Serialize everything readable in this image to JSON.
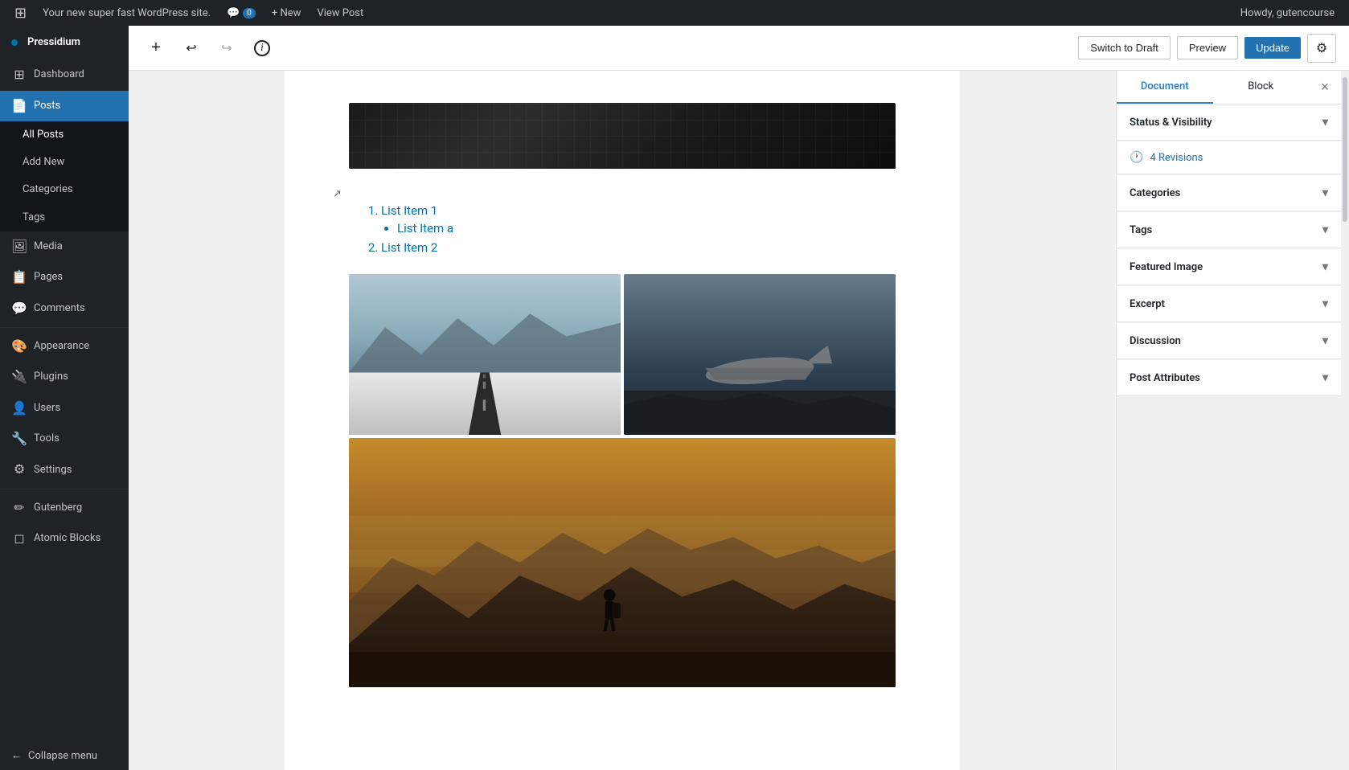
{
  "adminBar": {
    "wpLogoLabel": "WordPress",
    "siteName": "Your new super fast WordPress site.",
    "commentsLabel": "Comments",
    "commentsCount": "0",
    "newLabel": "+ New",
    "viewPostLabel": "View Post",
    "howdy": "Howdy, gutencourse"
  },
  "sidebar": {
    "brandName": "Pressidium",
    "items": [
      {
        "id": "dashboard",
        "label": "Dashboard",
        "icon": "⊞"
      },
      {
        "id": "posts",
        "label": "Posts",
        "icon": "📄",
        "active": true
      },
      {
        "id": "media",
        "label": "Media",
        "icon": "🖼"
      },
      {
        "id": "pages",
        "label": "Pages",
        "icon": "📋"
      },
      {
        "id": "comments",
        "label": "Comments",
        "icon": "💬"
      },
      {
        "id": "appearance",
        "label": "Appearance",
        "icon": "🎨"
      },
      {
        "id": "plugins",
        "label": "Plugins",
        "icon": "🔌"
      },
      {
        "id": "users",
        "label": "Users",
        "icon": "👤"
      },
      {
        "id": "tools",
        "label": "Tools",
        "icon": "🔧"
      },
      {
        "id": "settings",
        "label": "Settings",
        "icon": "⚙"
      },
      {
        "id": "gutenberg",
        "label": "Gutenberg",
        "icon": "✏"
      },
      {
        "id": "atomic-blocks",
        "label": "Atomic Blocks",
        "icon": "◻"
      }
    ],
    "postsSubmenu": [
      {
        "id": "all-posts",
        "label": "All Posts",
        "active": true
      },
      {
        "id": "add-new",
        "label": "Add New"
      },
      {
        "id": "categories",
        "label": "Categories"
      },
      {
        "id": "tags",
        "label": "Tags"
      }
    ],
    "collapseLabel": "Collapse menu"
  },
  "toolbar": {
    "addBlockLabel": "+",
    "undoLabel": "↩",
    "redoLabel": "↪",
    "infoLabel": "ℹ",
    "switchToDraftLabel": "Switch to Draft",
    "previewLabel": "Preview",
    "updateLabel": "Update",
    "settingsLabel": "⚙"
  },
  "rightPanel": {
    "documentTabLabel": "Document",
    "blockTabLabel": "Block",
    "closeLabel": "×",
    "sections": [
      {
        "id": "status-visibility",
        "label": "Status & Visibility",
        "expanded": true
      },
      {
        "id": "revisions",
        "label": "4 Revisions",
        "icon": "🕐",
        "isRevisions": true
      },
      {
        "id": "categories",
        "label": "Categories",
        "expanded": false
      },
      {
        "id": "tags",
        "label": "Tags",
        "expanded": false
      },
      {
        "id": "featured-image",
        "label": "Featured Image",
        "expanded": false
      },
      {
        "id": "excerpt",
        "label": "Excerpt",
        "expanded": false
      },
      {
        "id": "discussion",
        "label": "Discussion",
        "expanded": false
      },
      {
        "id": "post-attributes",
        "label": "Post Attributes",
        "expanded": false
      }
    ]
  },
  "editor": {
    "list": {
      "items": [
        {
          "number": "1.",
          "text": "List Item 1",
          "subitems": [
            {
              "text": "List Item a"
            }
          ]
        },
        {
          "number": "2.",
          "text": "List Item 2",
          "subitems": []
        }
      ]
    },
    "images": [
      {
        "id": "snow-road",
        "alt": "Snow road"
      },
      {
        "id": "plane-wreck",
        "alt": "Plane wreck"
      },
      {
        "id": "mountain-sunset",
        "alt": "Mountain sunset"
      }
    ]
  }
}
